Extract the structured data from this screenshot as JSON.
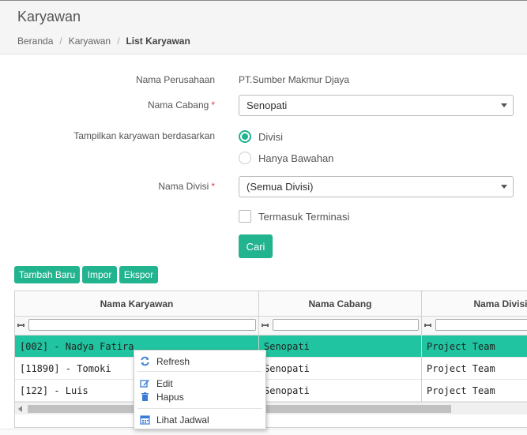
{
  "page": {
    "title": "Karyawan"
  },
  "breadcrumb": [
    "Beranda",
    "Karyawan",
    "List Karyawan"
  ],
  "form": {
    "company_label": "Nama Perusahaan",
    "company_value": "PT.Sumber Makmur Djaya",
    "branch_label": "Nama Cabang",
    "branch_value": "Senopati",
    "show_by_label": "Tampilkan karyawan berdasarkan",
    "show_by_options": [
      "Divisi",
      "Hanya Bawahan"
    ],
    "show_by_selected": "Divisi",
    "division_label": "Nama Divisi",
    "division_value": "(Semua Divisi)",
    "include_termination_label": "Termasuk Terminasi",
    "include_termination_checked": false,
    "search_button": "Cari",
    "required_mark": "*"
  },
  "toolbar": {
    "add_label": "Tambah Baru",
    "import_label": "Impor",
    "export_label": "Ekspor"
  },
  "grid": {
    "columns": [
      "Nama Karyawan",
      "Nama Cabang",
      "Nama Divisi"
    ],
    "rows": [
      [
        "[002] - Nadya Fatira",
        "Senopati",
        "Project Team"
      ],
      [
        "[11890] - Tomoki",
        "Senopati",
        "Project Team"
      ],
      [
        "[122] - Luis",
        "Senopati",
        "Project Team"
      ]
    ],
    "selected_row": 0
  },
  "context_menu": {
    "refresh": "Refresh",
    "edit": "Edit",
    "delete": "Hapus",
    "schedule": "Lihat Jadwal"
  },
  "colors": {
    "accent": "#22b38f",
    "selected_row": "#20c4a0",
    "icon_blue": "#3a7bd5"
  }
}
